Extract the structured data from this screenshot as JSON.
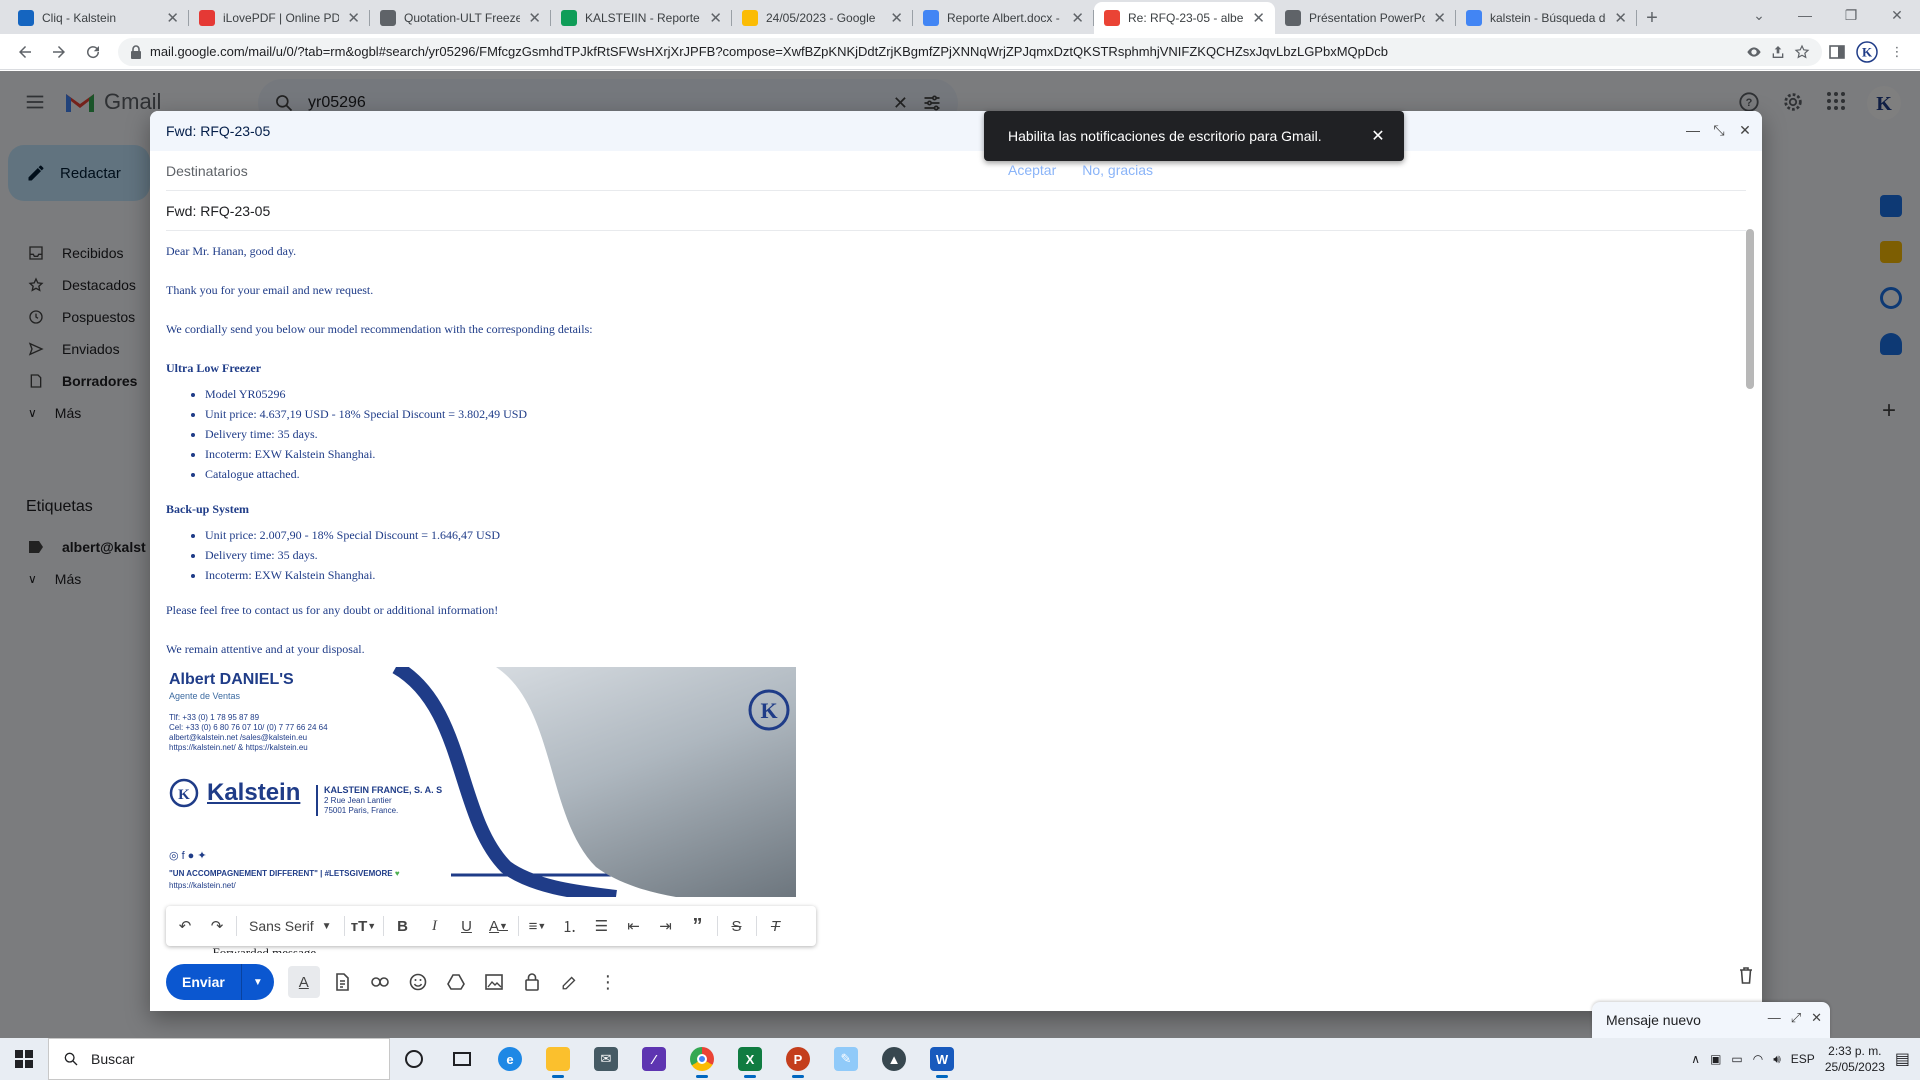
{
  "browser": {
    "tabs": [
      {
        "title": "Cliq - Kalstein",
        "color": "#1565c0",
        "active": false
      },
      {
        "title": "iLovePDF | Online PDF",
        "color": "#e53935",
        "active": false
      },
      {
        "title": "Quotation-ULT Freezer",
        "color": "#5f6368",
        "active": false
      },
      {
        "title": "KALSTEIIN - Reporte G",
        "color": "#0f9d58",
        "active": false
      },
      {
        "title": "24/05/2023 - Google",
        "color": "#fbbc04",
        "active": false
      },
      {
        "title": "Reporte Albert.docx -",
        "color": "#4285f4",
        "active": false
      },
      {
        "title": "Re: RFQ-23-05 - alber",
        "color": "#ea4335",
        "active": true
      },
      {
        "title": "Présentation PowerPo",
        "color": "#5f6368",
        "active": false
      },
      {
        "title": "kalstein - Búsqueda de",
        "color": "#4285f4",
        "active": false
      }
    ],
    "url": "mail.google.com/mail/u/0/?tab=rm&ogbl#search/yr05296/FMfcgzGsmhdTPJkfRtSFWsHXrjXrJPFB?compose=XwfBZpKNKjDdtZrjKBgmfZPjXNNqWrjZPJqmxDztQKSTRsphmhjVNIFZKQCHZsxJqvLbzLGPbxMQpDcb"
  },
  "gmail": {
    "product": "Gmail",
    "search_query": "yr05296",
    "compose_label": "Redactar",
    "nav": [
      {
        "label": "Recibidos",
        "icon": "inbox-icon",
        "bold": false
      },
      {
        "label": "Destacados",
        "icon": "star-icon",
        "bold": false
      },
      {
        "label": "Pospuestos",
        "icon": "clock-icon",
        "bold": false
      },
      {
        "label": "Enviados",
        "icon": "send-icon",
        "bold": false
      },
      {
        "label": "Borradores",
        "icon": "draft-icon",
        "bold": true
      },
      {
        "label": "Más",
        "icon": "chevron-down-icon",
        "bold": false
      }
    ],
    "labels_title": "Etiquetas",
    "labels": [
      {
        "label": "albert@kalst",
        "icon": "label-icon"
      },
      {
        "label": "Más",
        "icon": "chevron-down-icon"
      }
    ]
  },
  "compose": {
    "window_title": "Fwd: RFQ-23-05",
    "recipients_placeholder": "Destinatarios",
    "subject": "Fwd: RFQ-23-05",
    "body": {
      "greeting": "Dear Mr. Hanan, good day.",
      "thanks": "Thank you for your email and new request.",
      "intro": "We cordially send you below our model recommendation with the corresponding details:",
      "section1": {
        "title": "Ultra Low Freezer",
        "items": [
          "Model YR05296",
          "Unit price: 4.637,19 USD - 18% Special Discount = 3.802,49 USD",
          "Delivery time: 35 days.",
          "Incoterm: EXW Kalstein Shanghai.",
          "Catalogue attached."
        ]
      },
      "section2": {
        "title": "Back-up System",
        "items": [
          "Unit price: 2.007,90 - 18% Special Discount = 1.646,47 USD",
          "Delivery time: 35 days.",
          "Incoterm: EXW Kalstein Shanghai."
        ]
      },
      "closing": "Please feel free to contact us for any doubt or additional information!",
      "remain": "We remain attentive and at your disposal.",
      "forwarded": "---------- Forwarded message ---------"
    },
    "signature": {
      "name": "Albert DANIEL'S",
      "role": "Agente de Ventas",
      "phone": "Tlf: +33 (0) 1 78 95 87 89",
      "cell": "Cel: +33 (0) 6 80 76 07 10/ (0) 7 77 66 24 64",
      "emails": "albert@kalstein.net /sales@kalstein.eu",
      "sites": "https://kalstein.net/ & https://kalstein.eu",
      "brand": "Kalstein",
      "company": "KALSTEIN FRANCE, S. A. S",
      "address1": "2 Rue Jean Lantier",
      "address2": "75001 Paris, France.",
      "slogan": "\"UN ACCOMPAGNEMENT DIFFERENT\"  |  #LETSGIVEMORE",
      "site": "https://kalstein.net/"
    },
    "toolbar": {
      "font": "Sans Serif"
    },
    "send_label": "Enviar"
  },
  "notification": {
    "text": "Habilita las notificaciones de escritorio para Gmail.",
    "accept": "Aceptar",
    "decline": "No, gracias"
  },
  "mini_compose": {
    "title": "Mensaje nuevo"
  },
  "taskbar": {
    "search": "Buscar",
    "lang": "ESP",
    "time": "2:33 p. m.",
    "date": "25/05/2023"
  }
}
